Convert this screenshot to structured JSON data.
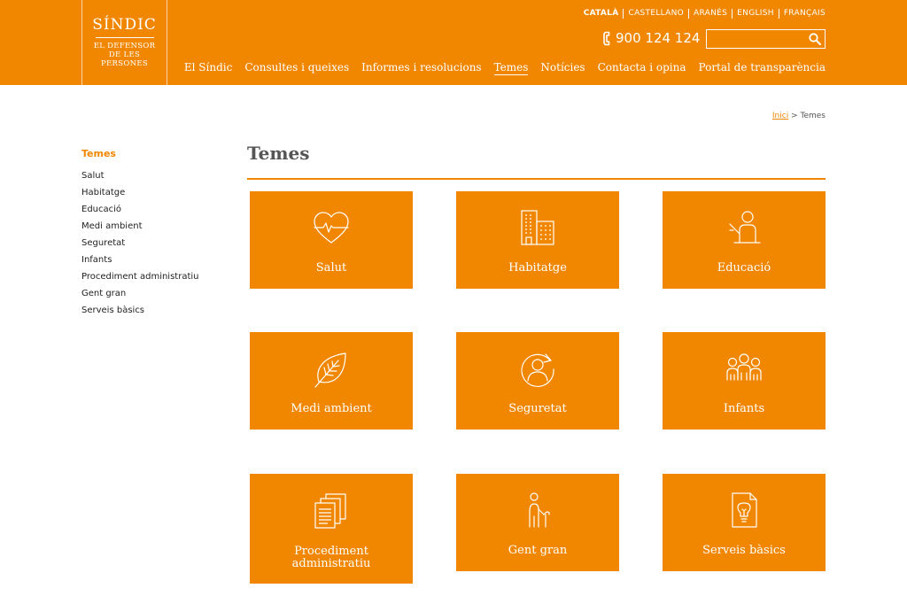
{
  "logo": {
    "title": "SÍNDIC",
    "subtitle": "EL DEFENSOR DE LES PERSONES"
  },
  "languages": [
    "CATALÀ",
    "CASTELLANO",
    "ARANÉS",
    "ENGLISH",
    "FRANÇAIS"
  ],
  "phone": {
    "number": "900 124 124",
    "icon": "phone-icon"
  },
  "search": {
    "value": "",
    "placeholder": "",
    "icon": "search-icon"
  },
  "nav": [
    "El Síndic",
    "Consultes i queixes",
    "Informes i resolucions",
    "Temes",
    "Notícies",
    "Contacta i opina",
    "Portal de transparència"
  ],
  "nav_active": "Temes",
  "breadcrumb": {
    "home": "Inici",
    "separator": ">",
    "current": "Temes"
  },
  "sidebar": {
    "title": "Temes",
    "items": [
      "Salut",
      "Habitatge",
      "Educació",
      "Medi ambient",
      "Seguretat",
      "Infants",
      "Procediment administratiu",
      "Gent gran",
      "Serveis bàsics"
    ]
  },
  "page_title": "Temes",
  "tiles": [
    {
      "label": "Salut",
      "icon": "heart-pulse-icon"
    },
    {
      "label": "Habitatge",
      "icon": "buildings-icon"
    },
    {
      "label": "Educació",
      "icon": "teacher-icon"
    },
    {
      "label": "Medi ambient",
      "icon": "leaf-icon"
    },
    {
      "label": "Seguretat",
      "icon": "person-circle-arrow-icon"
    },
    {
      "label": "Infants",
      "icon": "children-group-icon"
    },
    {
      "label": "Procediment administratiu",
      "icon": "documents-stack-icon"
    },
    {
      "label": "Gent gran",
      "icon": "elderly-cane-icon"
    },
    {
      "label": "Serveis bàsics",
      "icon": "document-lightbulb-icon"
    }
  ],
  "colors": {
    "brand": "#f18700",
    "text": "#333333"
  }
}
